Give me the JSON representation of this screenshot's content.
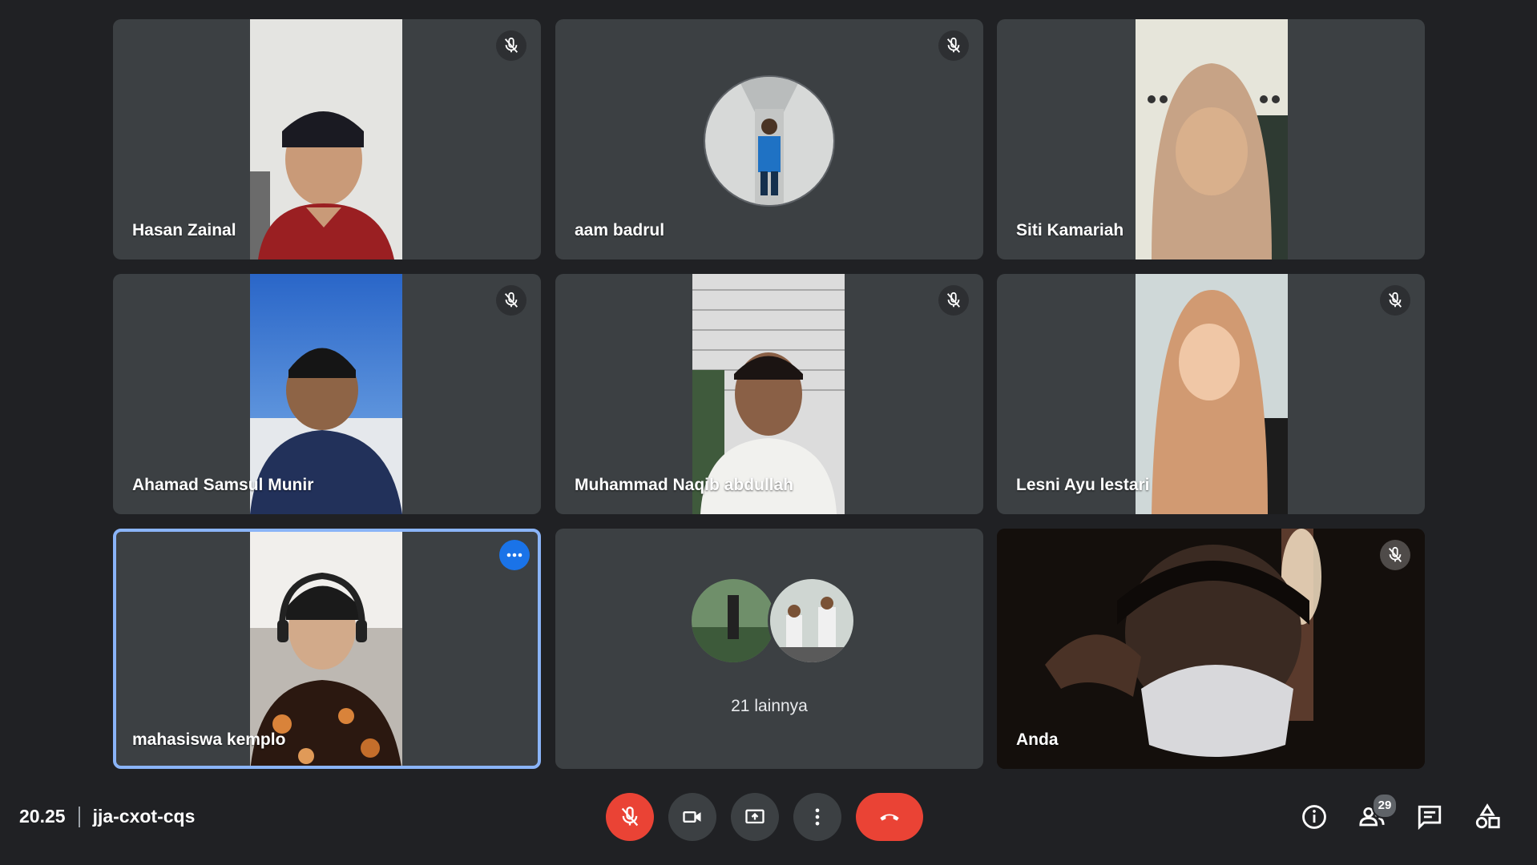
{
  "participants": [
    {
      "name": "Hasan Zainal"
    },
    {
      "name": "aam badrul"
    },
    {
      "name": "Siti Kamariah"
    },
    {
      "name": "Ahamad Samsul Munir"
    },
    {
      "name": "Muhammad Naqib abdullah"
    },
    {
      "name": "Lesni Ayu lestari"
    },
    {
      "name": "mahasiswa kemplo"
    },
    {
      "name": "Anda"
    }
  ],
  "others": {
    "label": "21 lainnya"
  },
  "meeting": {
    "time": "20.25",
    "code": "jja-cxot-cqs"
  },
  "people_count": "29",
  "icons": {
    "muted": "mic-off-icon",
    "more": "more-horiz-icon",
    "mic": "mic-off-icon",
    "camera": "videocam-icon",
    "present": "present-screen-icon",
    "more_options": "more-vert-icon",
    "end_call": "call-end-icon",
    "info": "info-icon",
    "people": "people-icon",
    "chat": "chat-icon",
    "activities": "activities-icon"
  },
  "colors": {
    "background": "#202124",
    "tile": "#3c4043",
    "end_call": "#ea4335",
    "accent": "#1a73e8",
    "selected_border": "#8ab4f8"
  }
}
